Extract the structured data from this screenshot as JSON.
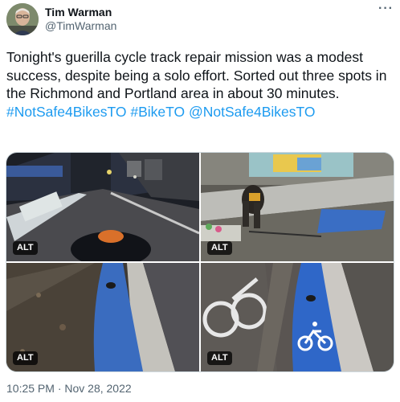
{
  "author": {
    "name": "Tim Warman",
    "handle": "@TimWarman"
  },
  "icons": {
    "more": "more-options-icon"
  },
  "tweet": {
    "segments": [
      {
        "text": "Tonight's guerilla cycle track repair mission was a modest success, despite being a solo effort. Sorted out three spots in the Richmond and Portland area in about 30 minutes. ",
        "type": "text"
      },
      {
        "text": "#NotSafe4BikesTO",
        "type": "hashtag"
      },
      {
        "text": " ",
        "type": "text"
      },
      {
        "text": "#BikeTO",
        "type": "hashtag"
      },
      {
        "text": " ",
        "type": "text"
      },
      {
        "text": "@NotSafe4BikesTO",
        "type": "mention"
      }
    ]
  },
  "media": {
    "alt_badges": [
      "ALT",
      "ALT",
      "ALT",
      "ALT"
    ]
  },
  "timestamp": "10:25 PM · Nov 28, 2022",
  "colors": {
    "link": "#1d9bf0",
    "text": "#0f1419",
    "secondary": "#536471"
  }
}
